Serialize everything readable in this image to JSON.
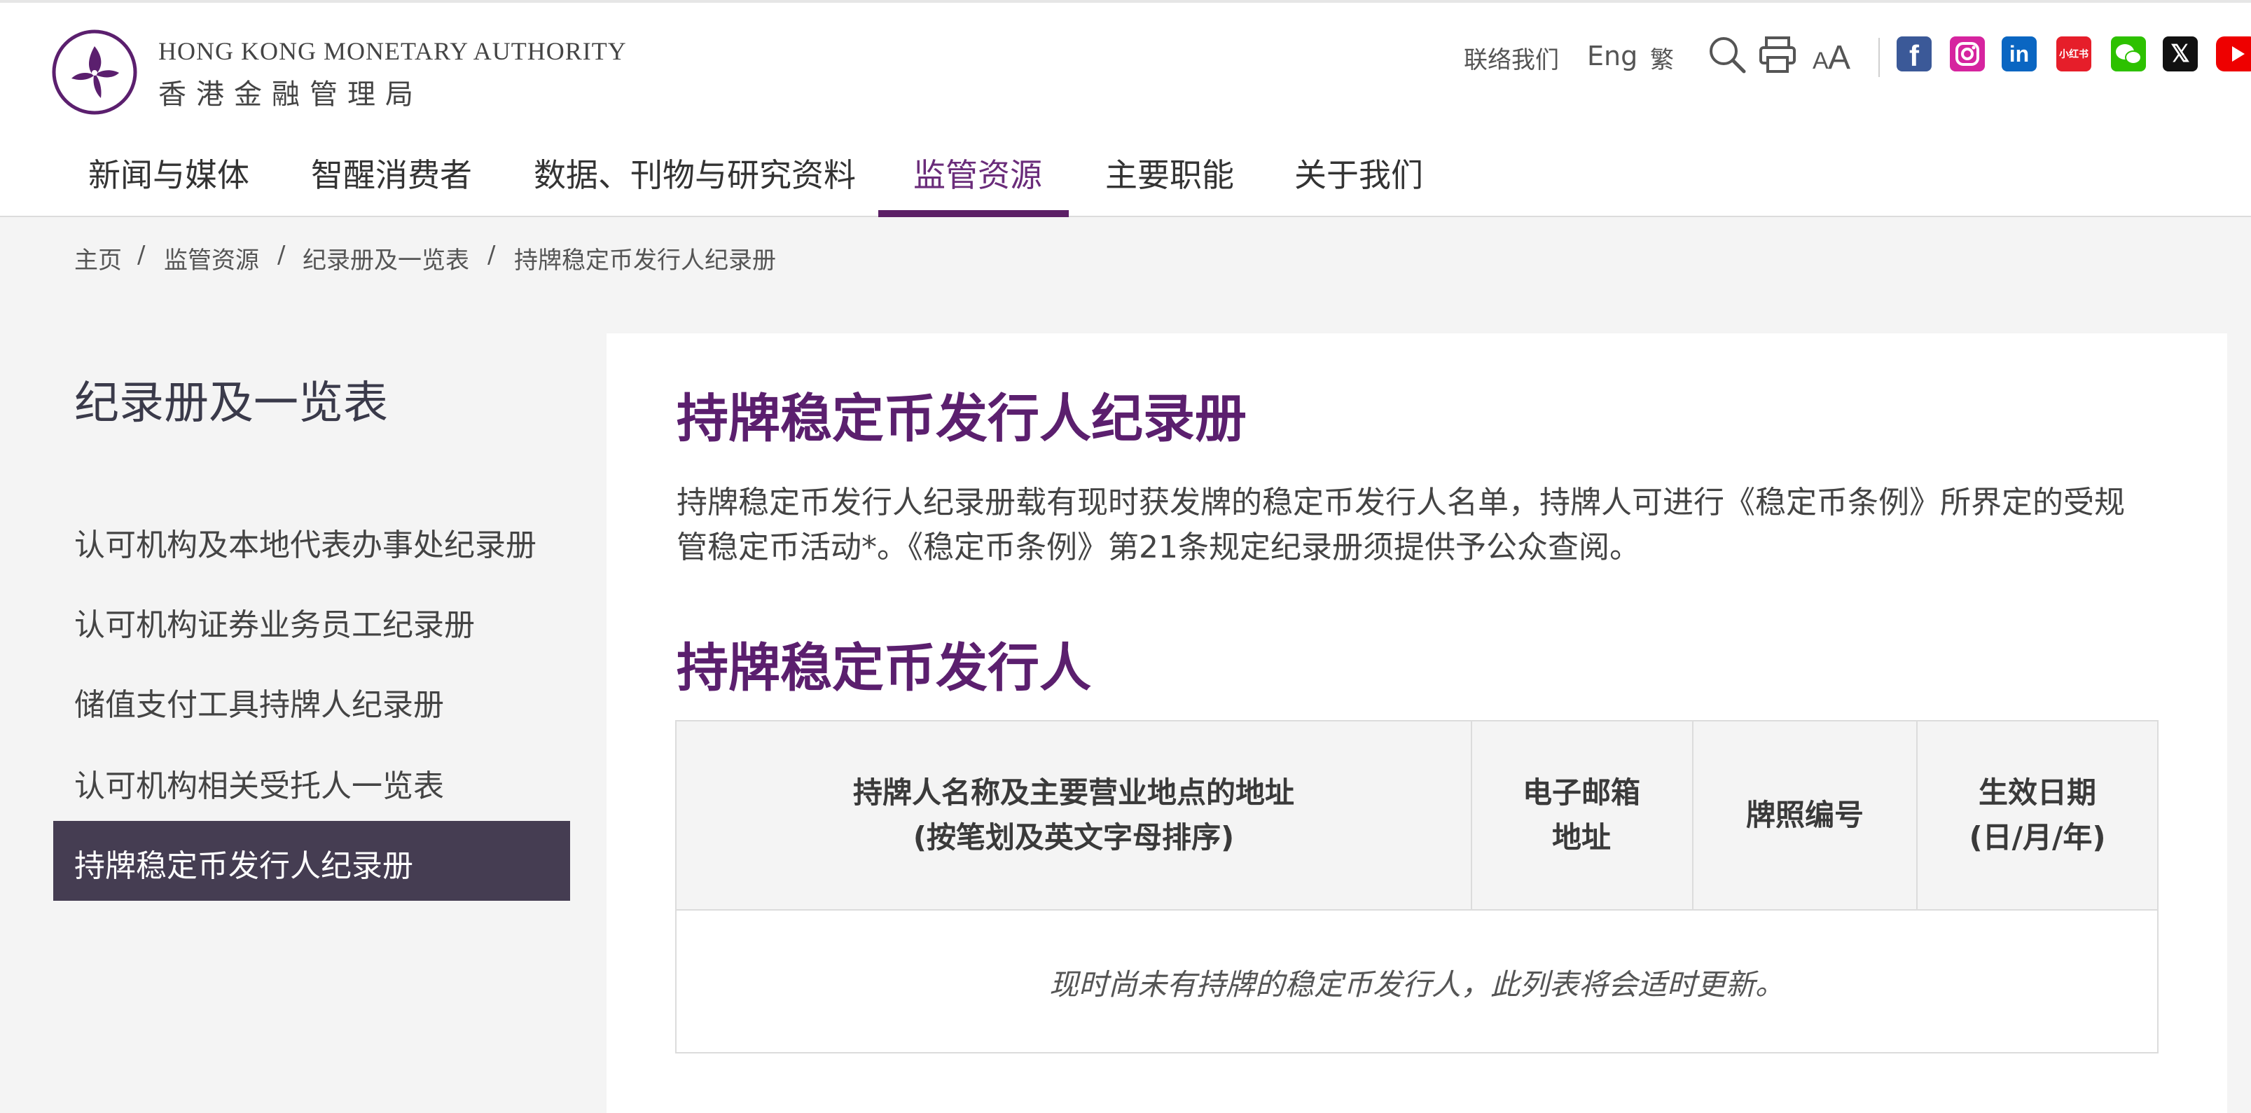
{
  "header": {
    "logo_en": "HONG KONG MONETARY AUTHORITY",
    "logo_zh": "香港金融管理局",
    "util": {
      "contact": "联络我们",
      "eng": "Eng",
      "trad": "繁"
    },
    "icons": [
      "search-icon",
      "print-icon",
      "font-size-icon"
    ],
    "social": {
      "facebook": "f",
      "instagram": "",
      "linkedin": "in",
      "xiaohongshu": "小红书",
      "wechat": "",
      "x": "𝕏",
      "youtube": ""
    }
  },
  "nav": {
    "items": [
      "新闻与媒体",
      "智醒消费者",
      "数据、刊物与研究资料",
      "监管资源",
      "主要职能",
      "关于我们"
    ],
    "active_index": 3
  },
  "breadcrumb": {
    "items": [
      "主页",
      "监管资源",
      "纪录册及一览表",
      "持牌稳定币发行人纪录册"
    ],
    "separator": "/"
  },
  "sidebar": {
    "title": "纪录册及一览表",
    "items": [
      "认可机构及本地代表办事处纪录册",
      "认可机构证券业务员工纪录册",
      "储值支付工具持牌人纪录册",
      "认可机构相关受托人一览表",
      "持牌稳定币发行人纪录册"
    ],
    "active_index": 4
  },
  "main": {
    "title": "持牌稳定币发行人纪录册",
    "intro": "持牌稳定币发行人纪录册载有现时获发牌的稳定币发行人名单，持牌人可进行《稳定币条例》所界定的受规管稳定币活动*。《稳定币条例》第21条规定纪录册须提供予公众查阅。",
    "section_title": "持牌稳定币发行人",
    "table": {
      "headers": [
        "持牌人名称及主要营业地点的地址\n(按笔划及英文字母排序)",
        "电子邮箱地址",
        "牌照编号",
        "生效日期\n(日/月/年)"
      ],
      "empty_message": "现时尚未有持牌的稳定币发行人，此列表将会适时更新。"
    }
  },
  "colors": {
    "brand_purple": "#5b1f6e",
    "nav_active_underline": "#5c2066",
    "sidebar_active_bg": "#453d52",
    "page_bg": "#f4f4f4"
  }
}
